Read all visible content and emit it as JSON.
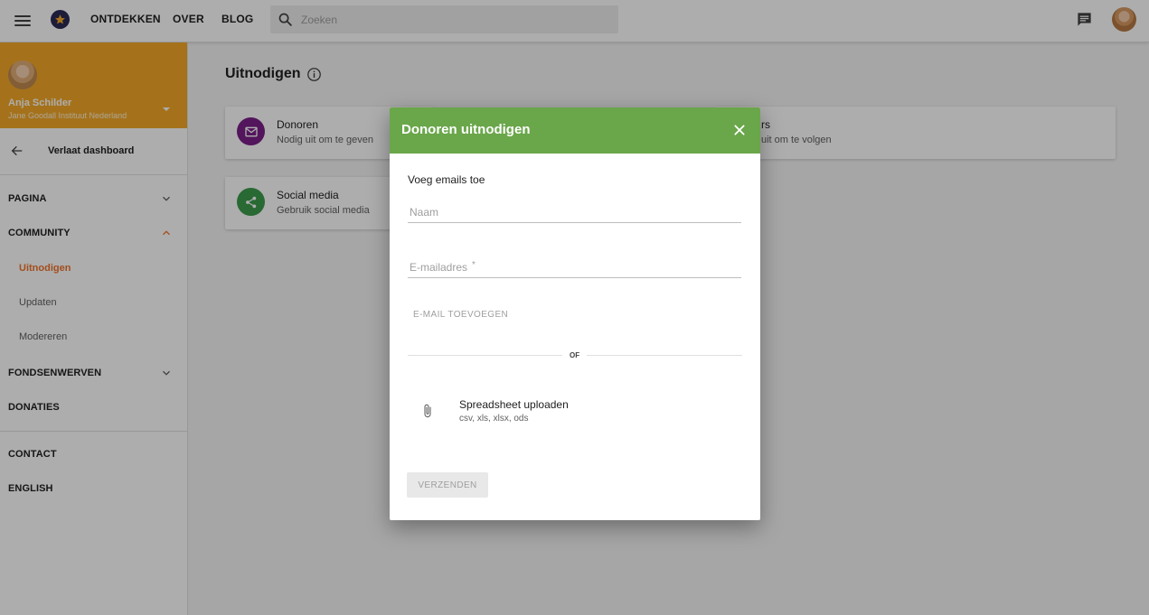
{
  "topbar": {
    "nav": [
      "ONTDEKKEN",
      "OVER",
      "BLOG"
    ],
    "search_placeholder": "Zoeken",
    "icons": {
      "menu": "hamburger-menu-icon",
      "search": "search-icon",
      "chat": "chat-icon"
    }
  },
  "sidebar": {
    "profile": {
      "name": "Anja Schilder",
      "organization": "Jane Goodall Instituut Nederland",
      "background": "#f4a928"
    },
    "back_label": "Verlaat dashboard",
    "items": [
      {
        "label": "PAGINA",
        "expanded": false
      },
      {
        "label": "COMMUNITY",
        "expanded": true
      },
      {
        "label": "FONDSENWERVEN",
        "expanded": false
      },
      {
        "label": "DONATIES"
      },
      {
        "label": "CONTACT"
      },
      {
        "label": "ENGLISH"
      }
    ],
    "community_subitems": [
      {
        "label": "Uitnodigen",
        "active": true
      },
      {
        "label": "Updaten",
        "active": false
      },
      {
        "label": "Modereren",
        "active": false
      }
    ],
    "active_color": "#f0742b"
  },
  "main": {
    "title": "Uitnodigen",
    "cards": [
      {
        "title": "Donoren",
        "subtitle": "Nodig uit om te geven",
        "icon": "mail-icon",
        "color": "#7b1f88"
      },
      {
        "title": "rs",
        "subtitle": "uit om te volgen"
      },
      {
        "title": "Social media",
        "subtitle": "Gebruik social media",
        "icon": "share-icon",
        "color": "#3d9b4c"
      }
    ]
  },
  "dialog": {
    "title": "Donoren uitnodigen",
    "header_color": "#6aa64a",
    "section_label": "Voeg emails toe",
    "name_placeholder": "Naam",
    "email_placeholder": "E-mailadres",
    "required_mark": "*",
    "add_email_label": "E-MAIL TOEVOEGEN",
    "or_label": "OF",
    "upload_title": "Spreadsheet uploaden",
    "upload_formats": "csv, xls, xlsx, ods",
    "send_label": "VERZENDEN"
  }
}
